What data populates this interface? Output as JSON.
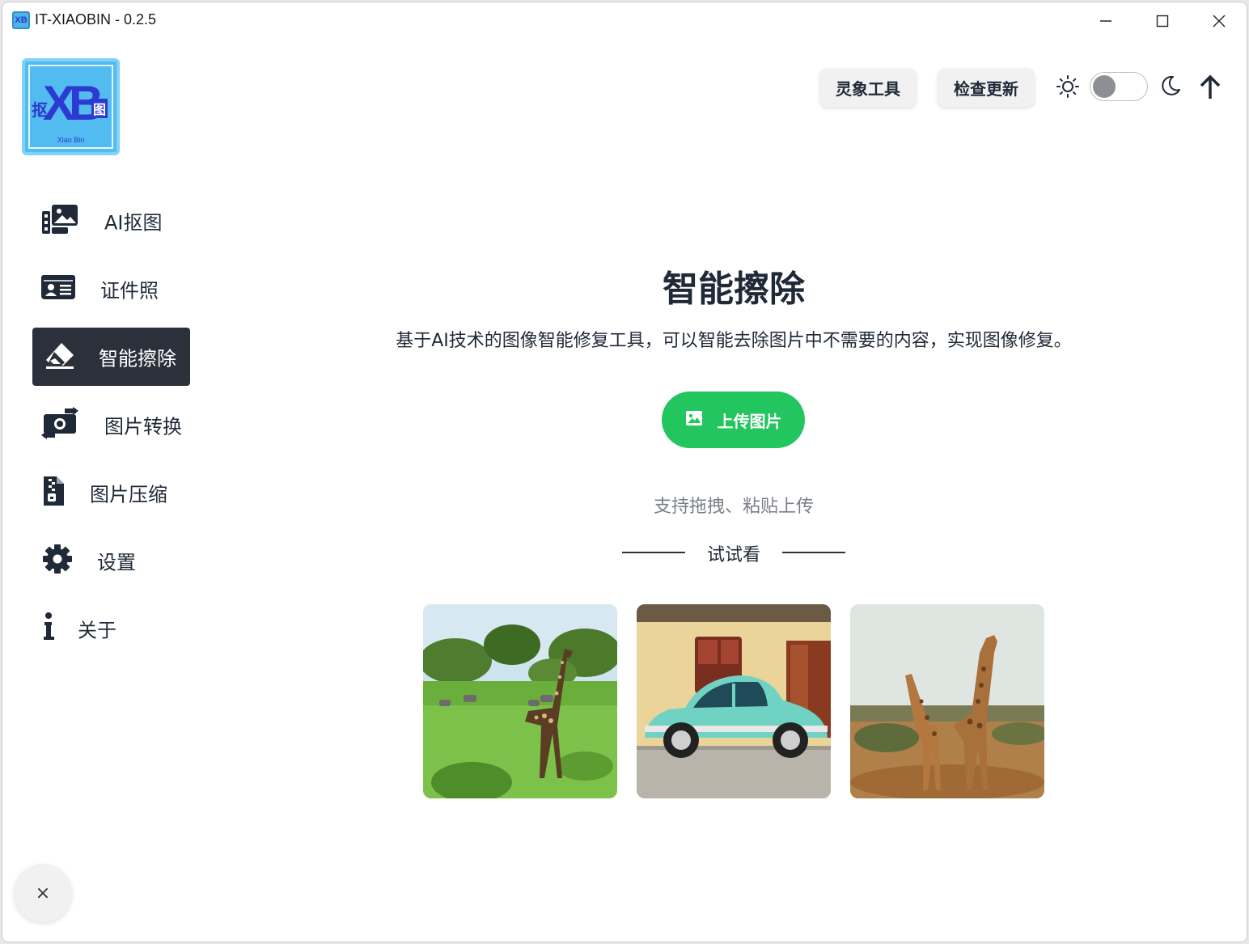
{
  "window": {
    "title": "IT-XIAOBIN - 0.2.5",
    "app_icon_text": "XB"
  },
  "logo": {
    "main": "XB",
    "left_char": "抠",
    "right_char": "图",
    "sub": "Xiao Bin"
  },
  "sidebar": {
    "items": [
      {
        "label": "AI抠图",
        "icon": "image-gallery-icon",
        "active": false
      },
      {
        "label": "证件照",
        "icon": "id-card-icon",
        "active": false
      },
      {
        "label": "智能擦除",
        "icon": "eraser-icon",
        "active": true
      },
      {
        "label": "图片转换",
        "icon": "convert-image-icon",
        "active": false
      },
      {
        "label": "图片压缩",
        "icon": "file-zip-icon",
        "active": false
      },
      {
        "label": "设置",
        "icon": "gear-icon",
        "active": false
      },
      {
        "label": "关于",
        "icon": "info-icon",
        "active": false
      }
    ],
    "close_label": "×"
  },
  "header": {
    "tools_button": "灵象工具",
    "update_button": "检查更新",
    "theme_dark": false
  },
  "main": {
    "title": "智能擦除",
    "description": "基于AI技术的图像智能修复工具，可以智能去除图片中不需要的内容，实现图像修复。",
    "upload_label": "上传图片",
    "hint": "支持拖拽、粘贴上传",
    "try_label": "试试看"
  },
  "samples": [
    {
      "name": "giraffe-savanna"
    },
    {
      "name": "vintage-car"
    },
    {
      "name": "two-giraffes"
    }
  ],
  "colors": {
    "accent": "#22c55e",
    "nav_active_bg": "#2b303b",
    "logo_bg": "#52bcf0"
  }
}
